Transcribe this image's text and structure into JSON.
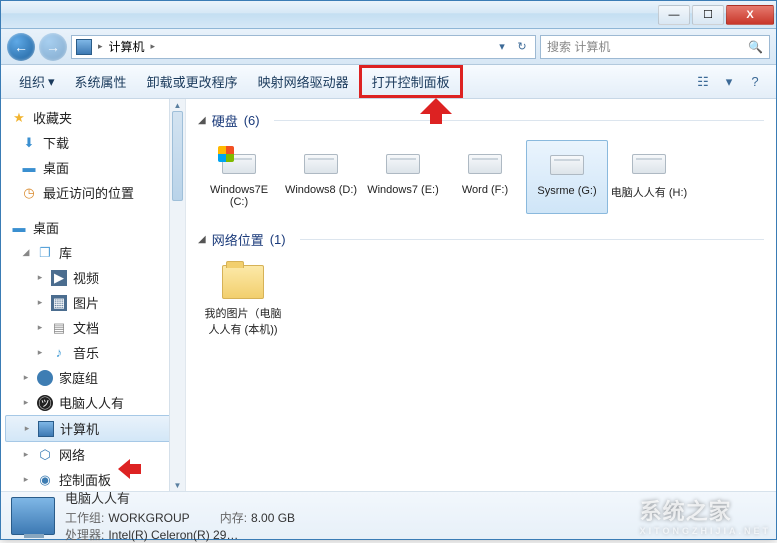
{
  "titlebar": {
    "min": "—",
    "max": "☐",
    "close": "X"
  },
  "nav": {
    "back": "←",
    "fwd": "→",
    "crumb": "计算机",
    "chev": "▸",
    "dd": "▾",
    "refresh": "↻"
  },
  "search": {
    "placeholder": "搜索 计算机",
    "icon": "🔍"
  },
  "toolbar": {
    "organize": "组织",
    "orgchev": "▾",
    "sysprops": "系统属性",
    "uninstall": "卸载或更改程序",
    "mapnet": "映射网络驱动器",
    "opencp": "打开控制面板",
    "viewicon": "☷",
    "viewchev": "▾",
    "help": "?"
  },
  "sidebar": {
    "favorites": "收藏夹",
    "downloads": "下载",
    "desktop": "桌面",
    "recent": "最近访问的位置",
    "desktop2": "桌面",
    "libraries": "库",
    "videos": "视频",
    "pictures": "图片",
    "documents": "文档",
    "music": "音乐",
    "homegroup": "家庭组",
    "pcuser": "电脑人人有",
    "computer": "计算机",
    "network": "网络",
    "controlpanel": "控制面板"
  },
  "groups": {
    "hdd": {
      "label": "硬盘",
      "count": "(6)",
      "tri": "◢"
    },
    "netloc": {
      "label": "网络位置",
      "count": "(1)",
      "tri": "◢"
    }
  },
  "drives": [
    {
      "name": "Windows7E (C:)",
      "flag": true
    },
    {
      "name": "Windows8 (D:)",
      "flag": false
    },
    {
      "name": "Windows7 (E:)",
      "flag": false
    },
    {
      "name": "Word (F:)",
      "flag": false
    },
    {
      "name": "Sysrme (G:)",
      "flag": false,
      "sel": true
    },
    {
      "name": "电脑人人有 (H:)",
      "flag": false
    }
  ],
  "netitem": "我的图片（电脑人人有 (本机))",
  "status": {
    "name": "电脑人人有",
    "wg_lbl": "工作组:",
    "wg": "WORKGROUP",
    "mem_lbl": "内存:",
    "mem": "8.00 GB",
    "cpu_lbl": "处理器:",
    "cpu": "Intel(R) Celeron(R) 29…"
  },
  "watermark": {
    "main": "系统之家",
    "sub": "XITONGZHIJIA.NET"
  }
}
